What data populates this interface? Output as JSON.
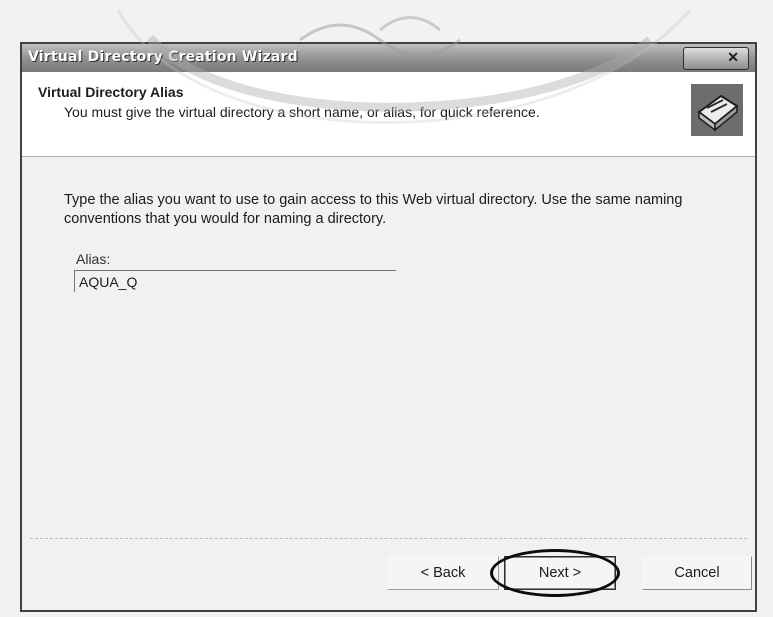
{
  "window": {
    "title": "Virtual Directory Creation Wizard"
  },
  "header": {
    "title": "Virtual Directory Alias",
    "subtitle": "You must give the virtual directory a short name, or alias, for quick reference."
  },
  "content": {
    "instructions": "Type the alias you want to use to gain access to this Web virtual directory. Use the same naming conventions that you would for naming a directory.",
    "alias_label": "Alias:",
    "alias_value": "AQUA_Q"
  },
  "buttons": {
    "back": "< Back",
    "next": "Next >",
    "cancel": "Cancel"
  },
  "icons": {
    "close": "close-icon",
    "wizard": "wizard-book-icon"
  },
  "annotation": {
    "highlighted_element": "next-button"
  }
}
